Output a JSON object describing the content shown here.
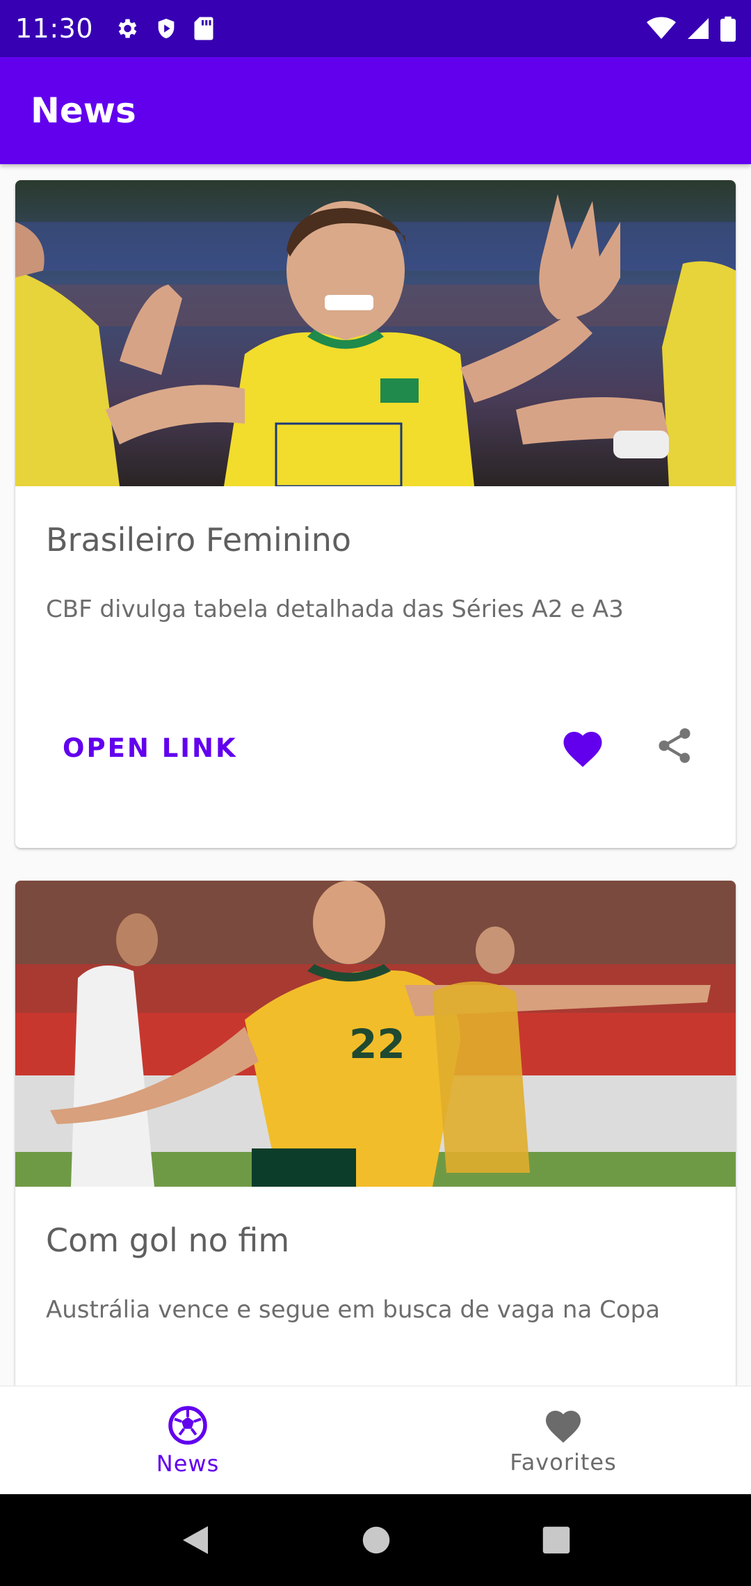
{
  "status_bar": {
    "time": "11:30",
    "left_icons": [
      "gear-icon",
      "shield-play-icon",
      "sd-card-icon"
    ],
    "right_icons": [
      "wifi-icon",
      "signal-icon",
      "battery-icon"
    ]
  },
  "app_bar": {
    "title": "News"
  },
  "feed": {
    "cards": [
      {
        "title": "Brasileiro Feminino",
        "description": "CBF divulga tabela detalhada das Séries A2 e A3",
        "image": "volleyball-player-photo",
        "action_label": "OPEN LINK",
        "favorite_icon": "heart-icon",
        "share_icon": "share-icon"
      },
      {
        "title": "Com gol no fim",
        "description": "Austrália vence e segue em busca de vaga na Copa",
        "image": "soccer-player-photo"
      }
    ]
  },
  "bottom_nav": {
    "items": [
      {
        "label": "News",
        "icon": "soccer-ball-icon",
        "active": true
      },
      {
        "label": "Favorites",
        "icon": "heart-icon",
        "active": false
      }
    ]
  },
  "colors": {
    "primary": "#6200EE",
    "primary_dark": "#3700B3",
    "inactive": "#6B6B6B"
  }
}
